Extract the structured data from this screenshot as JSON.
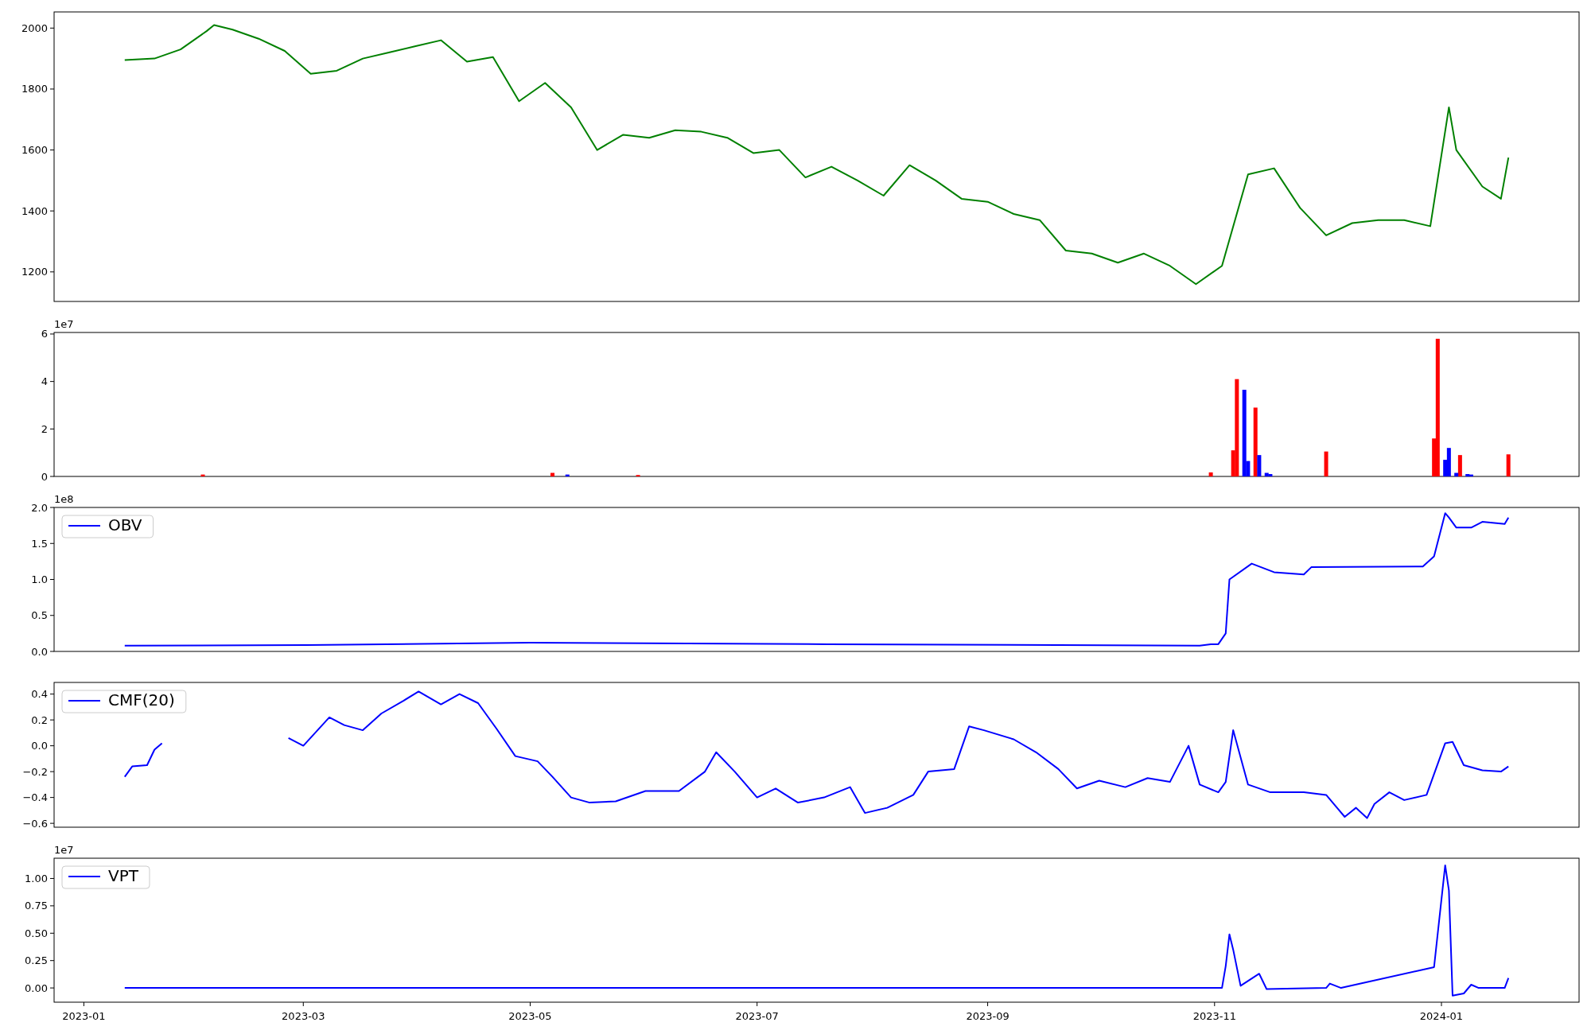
{
  "panels": [
    {
      "chart_data": {
        "type": "line",
        "xlim": [
          "2022-12-24",
          "2024-02-07"
        ],
        "ylim": [
          1103,
          2053
        ],
        "yticks": [
          1200,
          1400,
          1600,
          1800,
          2000
        ],
        "x": [
          "2023-01-12",
          "2023-01-20",
          "2023-01-27",
          "2023-02-03",
          "2023-02-05",
          "2023-02-10",
          "2023-02-17",
          "2023-02-24",
          "2023-03-03",
          "2023-03-10",
          "2023-03-17",
          "2023-03-24",
          "2023-03-31",
          "2023-04-07",
          "2023-04-14",
          "2023-04-21",
          "2023-04-28",
          "2023-05-05",
          "2023-05-12",
          "2023-05-19",
          "2023-05-26",
          "2023-06-02",
          "2023-06-09",
          "2023-06-16",
          "2023-06-23",
          "2023-06-30",
          "2023-07-07",
          "2023-07-14",
          "2023-07-21",
          "2023-07-28",
          "2023-08-04",
          "2023-08-11",
          "2023-08-18",
          "2023-08-25",
          "2023-09-01",
          "2023-09-08",
          "2023-09-15",
          "2023-09-22",
          "2023-09-29",
          "2023-10-06",
          "2023-10-13",
          "2023-10-20",
          "2023-10-27",
          "2023-11-03",
          "2023-11-10",
          "2023-11-17",
          "2023-11-24",
          "2023-12-01",
          "2023-12-08",
          "2023-12-15",
          "2023-12-22",
          "2023-12-29",
          "2024-01-03",
          "2024-01-05",
          "2024-01-12",
          "2024-01-17",
          "2024-01-19"
        ],
        "series": [
          {
            "color": "#008000",
            "values": [
              1895,
              1900,
              1930,
              1990,
              2010,
              1995,
              1965,
              1925,
              1850,
              1860,
              1900,
              1920,
              1940,
              1960,
              1890,
              1905,
              1760,
              1820,
              1740,
              1600,
              1650,
              1640,
              1665,
              1660,
              1640,
              1590,
              1600,
              1510,
              1545,
              1500,
              1450,
              1550,
              1500,
              1440,
              1430,
              1390,
              1370,
              1270,
              1260,
              1230,
              1260,
              1220,
              1160,
              1220,
              1520,
              1540,
              1410,
              1320,
              1360,
              1370,
              1370,
              1350,
              1740,
              1600,
              1480,
              1440,
              1575
            ]
          }
        ]
      }
    },
    {
      "scale_label": "1e7",
      "chart_data": {
        "type": "bar",
        "xlim": [
          "2022-12-24",
          "2024-02-07"
        ],
        "ylim": [
          0,
          6.065
        ],
        "yticks": [
          0,
          2,
          4,
          6
        ],
        "x": [
          "2023-02-02",
          "2023-05-07",
          "2023-05-11",
          "2023-05-30",
          "2023-10-31",
          "2023-11-06",
          "2023-11-07",
          "2023-11-09",
          "2023-11-10",
          "2023-11-12",
          "2023-11-13",
          "2023-11-15",
          "2023-11-16",
          "2023-12-01",
          "2023-12-30",
          "2023-12-31",
          "2024-01-02",
          "2024-01-03",
          "2024-01-05",
          "2024-01-06",
          "2024-01-08",
          "2024-01-09",
          "2024-01-19"
        ],
        "series": [
          {
            "color": "#ff0000",
            "values": [
              0.08,
              0.15,
              null,
              0.06,
              0.17,
              1.1,
              4.1,
              null,
              null,
              2.9,
              null,
              null,
              null,
              1.05,
              1.6,
              5.8,
              null,
              null,
              null,
              0.9,
              null,
              null,
              0.93
            ]
          },
          {
            "color": "#0000ff",
            "values": [
              null,
              null,
              0.08,
              null,
              null,
              null,
              null,
              3.65,
              0.65,
              null,
              0.9,
              0.15,
              0.1,
              null,
              null,
              null,
              0.7,
              1.2,
              0.15,
              null,
              0.1,
              0.08,
              null
            ]
          }
        ]
      }
    },
    {
      "scale_label": "1e8",
      "chart_data": {
        "type": "line",
        "xlim": [
          "2022-12-24",
          "2024-02-07"
        ],
        "ylim": [
          0,
          2.0
        ],
        "yticks": [
          {
            "value": 0,
            "label": "0.0"
          },
          {
            "value": 0.5,
            "label": "0.5"
          },
          {
            "value": 1,
            "label": "1.0"
          },
          {
            "value": 1.5,
            "label": "1.5"
          },
          {
            "value": 2,
            "label": "2.0"
          }
        ],
        "x": [
          "2023-01-12",
          "2023-03-02",
          "2023-05-01",
          "2023-07-20",
          "2023-10-28",
          "2023-10-31",
          "2023-11-02",
          "2023-11-04",
          "2023-11-05",
          "2023-11-11",
          "2023-11-17",
          "2023-11-25",
          "2023-11-27",
          "2023-12-27",
          "2023-12-30",
          "2024-01-02",
          "2024-01-03",
          "2024-01-05",
          "2024-01-09",
          "2024-01-12",
          "2024-01-18",
          "2024-01-19"
        ],
        "series": [
          {
            "name": "OBV",
            "color": "#0000ff",
            "values": [
              0.08,
              0.09,
              0.12,
              0.1,
              0.08,
              0.1,
              0.1,
              0.25,
              1.0,
              1.22,
              1.1,
              1.07,
              1.17,
              1.18,
              1.32,
              1.92,
              1.86,
              1.72,
              1.72,
              1.8,
              1.77,
              1.86
            ]
          }
        ]
      }
    },
    {
      "chart_data": {
        "type": "line",
        "xlim": [
          "2022-12-24",
          "2024-02-07"
        ],
        "ylim": [
          -0.63,
          0.49
        ],
        "yticks": [
          {
            "value": -0.6,
            "label": "−0.6"
          },
          {
            "value": -0.4,
            "label": "−0.4"
          },
          {
            "value": -0.2,
            "label": "−0.2"
          },
          {
            "value": 0,
            "label": "0.0"
          },
          {
            "value": 0.2,
            "label": "0.2"
          },
          {
            "value": 0.4,
            "label": "0.4"
          }
        ],
        "x": [
          "2023-01-12",
          "2023-01-14",
          "2023-01-18",
          "2023-01-20",
          "2023-01-22",
          "2023-02-10",
          "2023-02-25",
          "2023-03-01",
          "2023-03-08",
          "2023-03-12",
          "2023-03-17",
          "2023-03-22",
          "2023-03-28",
          "2023-04-01",
          "2023-04-07",
          "2023-04-12",
          "2023-04-17",
          "2023-04-22",
          "2023-04-27",
          "2023-05-03",
          "2023-05-07",
          "2023-05-12",
          "2023-05-17",
          "2023-05-24",
          "2023-06-01",
          "2023-06-10",
          "2023-06-17",
          "2023-06-20",
          "2023-06-25",
          "2023-07-01",
          "2023-07-06",
          "2023-07-12",
          "2023-07-19",
          "2023-07-26",
          "2023-07-30",
          "2023-08-05",
          "2023-08-12",
          "2023-08-16",
          "2023-08-23",
          "2023-08-27",
          "2023-08-31",
          "2023-09-08",
          "2023-09-14",
          "2023-09-20",
          "2023-09-25",
          "2023-10-01",
          "2023-10-08",
          "2023-10-14",
          "2023-10-20",
          "2023-10-25",
          "2023-10-28",
          "2023-11-02",
          "2023-11-04",
          "2023-11-06",
          "2023-11-10",
          "2023-11-16",
          "2023-11-25",
          "2023-12-01",
          "2023-12-06",
          "2023-12-09",
          "2023-12-12",
          "2023-12-14",
          "2023-12-18",
          "2023-12-22",
          "2023-12-28",
          "2024-01-02",
          "2024-01-04",
          "2024-01-07",
          "2024-01-12",
          "2024-01-17",
          "2024-01-19"
        ],
        "series": [
          {
            "name": "CMF(20)",
            "color": "#0000ff",
            "values": [
              -0.24,
              -0.16,
              -0.15,
              -0.03,
              0.02,
              null,
              0.06,
              0.0,
              0.22,
              0.16,
              0.12,
              0.25,
              0.35,
              0.42,
              0.32,
              0.4,
              0.33,
              0.13,
              -0.08,
              -0.12,
              -0.24,
              -0.4,
              -0.44,
              -0.43,
              -0.35,
              -0.35,
              -0.2,
              -0.05,
              -0.2,
              -0.4,
              -0.33,
              -0.44,
              -0.4,
              -0.32,
              -0.52,
              -0.48,
              -0.38,
              -0.2,
              -0.18,
              0.15,
              0.12,
              0.05,
              -0.05,
              -0.18,
              -0.33,
              -0.27,
              -0.32,
              -0.25,
              -0.28,
              0.0,
              -0.3,
              -0.36,
              -0.28,
              0.12,
              -0.3,
              -0.36,
              -0.36,
              -0.38,
              -0.55,
              -0.48,
              -0.56,
              -0.45,
              -0.36,
              -0.42,
              -0.38,
              0.02,
              0.03,
              -0.15,
              -0.19,
              -0.2,
              -0.16
            ]
          }
        ]
      }
    },
    {
      "scale_label": "1e7",
      "chart_data": {
        "type": "line",
        "xlim": [
          "2022-12-24",
          "2024-02-07"
        ],
        "ylim": [
          -0.13,
          1.185
        ],
        "yticks": [
          {
            "value": 0,
            "label": "0.00"
          },
          {
            "value": 0.25,
            "label": "0.25"
          },
          {
            "value": 0.5,
            "label": "0.50"
          },
          {
            "value": 0.75,
            "label": "0.75"
          },
          {
            "value": 1,
            "label": "1.00"
          }
        ],
        "xticks": [
          {
            "value": "2023-01-01",
            "label": "2023-01"
          },
          {
            "value": "2023-03-01",
            "label": "2023-03"
          },
          {
            "value": "2023-05-01",
            "label": "2023-05"
          },
          {
            "value": "2023-07-01",
            "label": "2023-07"
          },
          {
            "value": "2023-09-01",
            "label": "2023-09"
          },
          {
            "value": "2023-11-01",
            "label": "2023-11"
          },
          {
            "value": "2024-01-01",
            "label": "2024-01"
          }
        ],
        "x": [
          "2023-01-12",
          "2023-04-11",
          "2023-07-20",
          "2023-10-28",
          "2023-11-03",
          "2023-11-04",
          "2023-11-05",
          "2023-11-06",
          "2023-11-08",
          "2023-11-13",
          "2023-11-15",
          "2023-12-01",
          "2023-12-02",
          "2023-12-05",
          "2023-12-30",
          "2024-01-02",
          "2024-01-03",
          "2024-01-04",
          "2024-01-07",
          "2024-01-09",
          "2024-01-11",
          "2024-01-18",
          "2024-01-19"
        ],
        "series": [
          {
            "name": "VPT",
            "color": "#0000ff",
            "values": [
              0,
              0,
              0,
              0,
              0,
              0.2,
              0.49,
              0.35,
              0.02,
              0.13,
              -0.01,
              0,
              0.04,
              0,
              0.19,
              1.12,
              0.89,
              -0.07,
              -0.05,
              0.03,
              0,
              0,
              0.09
            ]
          }
        ]
      }
    }
  ]
}
